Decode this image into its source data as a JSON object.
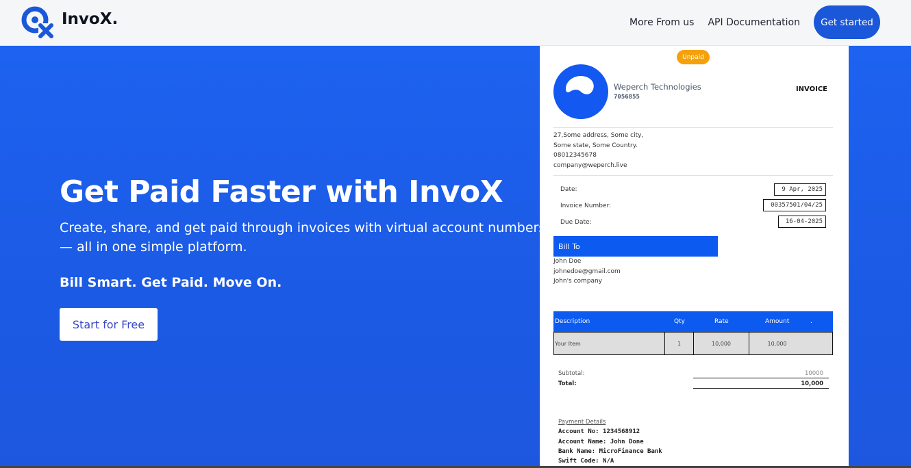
{
  "navbar": {
    "brand": "InvoX.",
    "links": [
      "More From us",
      "API Documentation"
    ],
    "cta": "Get started"
  },
  "hero": {
    "title": "Get Paid Faster with InvoX",
    "subtitle": "Create, share, and get paid through invoices with virtual account numbers — all in one simple platform.",
    "tagline": "Bill Smart. Get Paid. Move On.",
    "cta": "Start for Free"
  },
  "invoice": {
    "status": "Unpaid",
    "company": "Weperch Technologies",
    "company_id": "7056855",
    "heading": "INVOICE",
    "address": [
      "27,Some address, Some city,",
      "Some state, Some Country.",
      "08012345678",
      "company@weperch.live"
    ],
    "meta": [
      {
        "label": "Date:",
        "value": "9 Apr, 2025"
      },
      {
        "label": "Invoice Number:",
        "value": "00357501/04/25"
      },
      {
        "label": "Due Date:",
        "value": "16-04-2025"
      }
    ],
    "bill_to": {
      "title": "Bill To",
      "name": "John Doe",
      "email": "johnedoe@gmail.com",
      "company": "John's company"
    },
    "table": {
      "headers": [
        "Description",
        "Qty",
        "Rate",
        "Amount",
        "."
      ],
      "rows": [
        {
          "description": "Your Item",
          "qty": "1",
          "rate": "10,000",
          "amount": "10,000"
        }
      ]
    },
    "subtotal_label": "Subtotal:",
    "subtotal_value": "10000",
    "total_label": "Total:",
    "total_value": "10,000",
    "payment": {
      "title": "Payment Details",
      "lines": [
        "Account No: 1234568912",
        "Account Name: John Done",
        "Bank Name: MicroFinance Bank",
        "Swift Code: N/A"
      ]
    }
  },
  "colors": {
    "brand_blue": "#1a57d9",
    "hero_bg": "#1d5ce6",
    "badge_orange": "#f5a10c",
    "table_blue": "#0d5af0"
  }
}
